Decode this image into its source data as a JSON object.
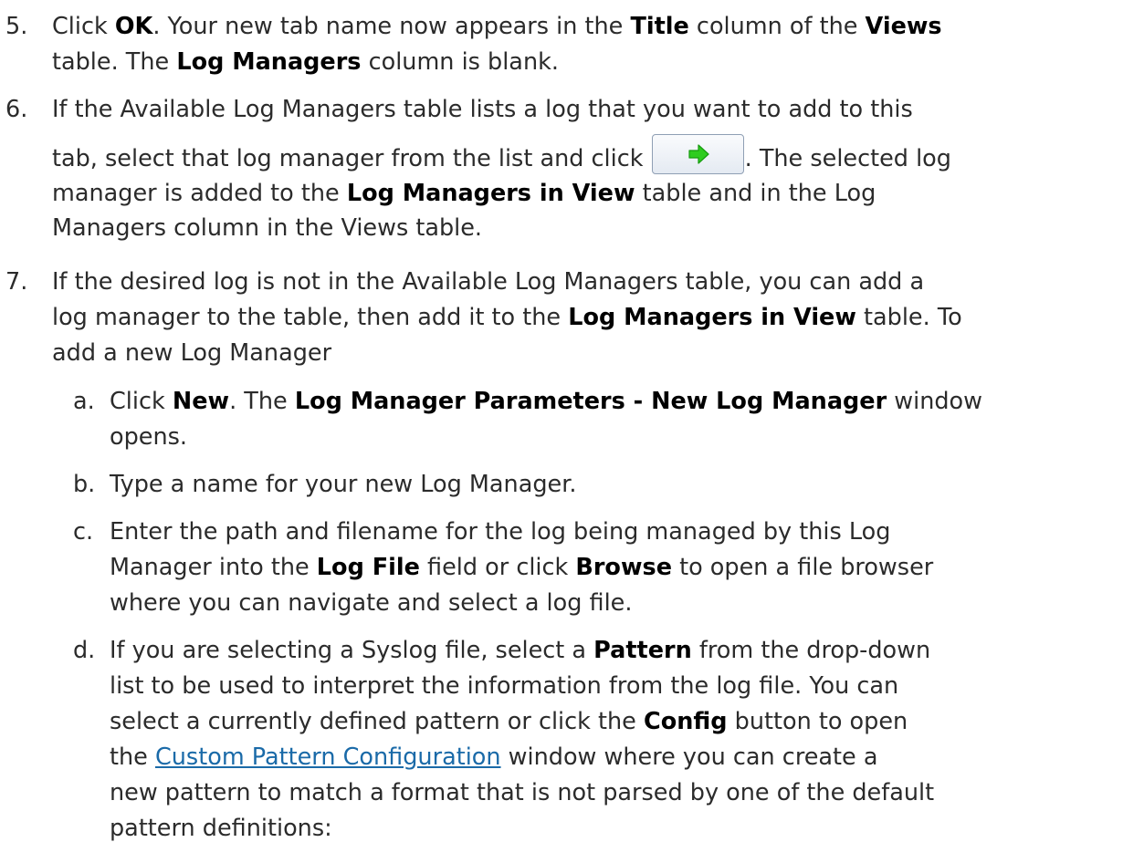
{
  "step5": {
    "num": "5.",
    "t1": "Click ",
    "ok": "OK",
    "t2": ". Your new tab name now appears in the ",
    "title": "Title",
    "t3": " column of the ",
    "views": "Views",
    "t4": "table. The ",
    "logmgrs": "Log Managers",
    "t5": " column is blank."
  },
  "step6": {
    "num": "6.",
    "l1": "If the Available Log Managers table lists a log that you want to add to this",
    "t1": "tab, select that log manager from the list and click ",
    "t2": ". The selected log",
    "t3": "manager is added to the ",
    "b1": "Log Managers in View",
    "t4": " table and in the Log",
    "l4": "Managers column in the Views table.",
    "button_icon": "green-right-arrow-icon",
    "arrow_color": "#2ecc1f"
  },
  "step7": {
    "num": "7.",
    "l1": "If the desired log is not in the Available Log Managers table, you can add a",
    "t1": "log manager to the table, then add it to the ",
    "b1": "Log Managers in View",
    "t2": " table. To",
    "l3": "add a new Log Manager"
  },
  "sub_a": {
    "num": "a.",
    "t1": "Click ",
    "b1": "New",
    "t2": ". The ",
    "b2": "Log Manager Parameters - New Log Manager",
    "t3": " window",
    "l2": "opens."
  },
  "sub_b": {
    "num": "b.",
    "l1": "Type a name for your new Log Manager."
  },
  "sub_c": {
    "num": "c.",
    "l1": "Enter the path and filename for the log being managed by this Log",
    "t1": "Manager into the ",
    "b1": "Log File",
    "t2": " field or click ",
    "b2": "Browse",
    "t3": " to open a file browser",
    "l3": "where you can navigate and select a log file."
  },
  "sub_d": {
    "num": "d.",
    "t1": "If you are selecting a Syslog file, select a ",
    "b1": "Pattern",
    "t2": " from the drop-down",
    "l2": "list to be used to interpret the information from the log file. You can",
    "t3": "select a currently defined pattern or click the ",
    "b2": "Config",
    "t4": " button to open",
    "t5": "the ",
    "link": "Custom Pattern Configuration",
    "t6": " window where you can create a",
    "l5": "new pattern to match a format that is not parsed by one of the default",
    "l6": "pattern definitions:"
  },
  "colors": {
    "text": "#2b2b2b",
    "link": "#1a6aa8"
  }
}
